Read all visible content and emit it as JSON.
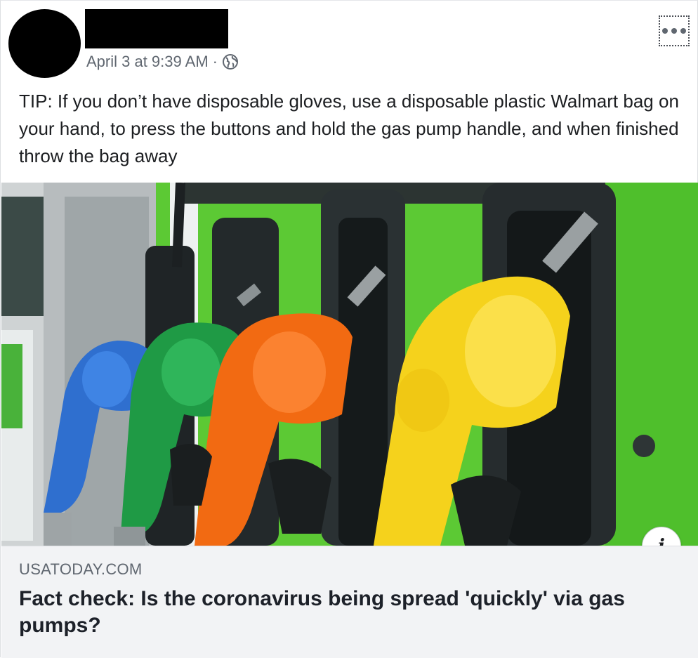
{
  "post": {
    "timestamp": "April 3 at 9:39 AM",
    "separator": "·",
    "privacy_icon": "globe-icon",
    "more_icon": "more-options-icon",
    "text": "TIP: If you don’t have disposable gloves, use a disposable plastic Walmart bag on your hand, to press the buttons and hold the gas pump handle, and when finished throw the bag away"
  },
  "link_preview": {
    "image_alt": "gas pump nozzles",
    "info_icon": "info-icon",
    "info_label": "i",
    "domain": "USATODAY.COM",
    "title": "Fact check: Is the coronavirus being spread 'quickly' via gas pumps?"
  },
  "colors": {
    "pump_green": "#57c52c",
    "nozzle_blue": "#2f6fcf",
    "nozzle_green": "#1f9a45",
    "nozzle_orange": "#f26a12",
    "nozzle_yellow": "#f5d21c",
    "meta_text": "#606770",
    "link_bg": "#f2f3f5"
  }
}
